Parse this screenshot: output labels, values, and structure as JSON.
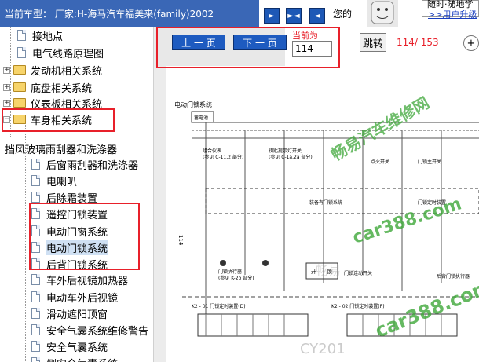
{
  "header": {
    "title": "当前车型： 厂家:H-海马汽车福美来(family)2002",
    "cut_text": "您的",
    "sign_text": "随时·随地学",
    "sign_link": ">>用户升级"
  },
  "sidebar": {
    "items": [
      {
        "label": "接地点",
        "type": "doc"
      },
      {
        "label": "电气线路原理图",
        "type": "doc"
      },
      {
        "label": "发动机相关系统",
        "type": "folder"
      },
      {
        "label": "底盘相关系统",
        "type": "folder"
      },
      {
        "label": "仪表板相关系统",
        "type": "folder"
      },
      {
        "label": "车身相关系统",
        "type": "folder-open"
      },
      {
        "label": "挡风玻璃雨刮器和洗涤器",
        "type": "doc"
      },
      {
        "label": "后窗雨刮器和洗涤器",
        "type": "doc"
      },
      {
        "label": "电喇叭",
        "type": "doc"
      },
      {
        "label": "后除霜装置",
        "type": "doc"
      },
      {
        "label": "遥控门锁装置",
        "type": "doc"
      },
      {
        "label": "电动门窗系统",
        "type": "doc"
      },
      {
        "label": "电动门锁系统",
        "type": "doc",
        "selected": true
      },
      {
        "label": "后背门锁系统",
        "type": "doc"
      },
      {
        "label": "车外后视镜加热器",
        "type": "doc"
      },
      {
        "label": "电动车外后视镜",
        "type": "doc"
      },
      {
        "label": "滑动遮阳顶窗",
        "type": "doc"
      },
      {
        "label": "安全气囊系统维修警告",
        "type": "doc"
      },
      {
        "label": "安全气囊系统",
        "type": "doc"
      },
      {
        "label": "侧安全气囊系统",
        "type": "doc"
      }
    ]
  },
  "toolbar": {
    "prev_label": "上 一 页",
    "next_label": "下 一 页",
    "current_label": "当前为",
    "current_value": "114",
    "jump_label": "跳转",
    "page_count": "114/ 153"
  },
  "diagram": {
    "title": "电动门锁系统",
    "box_label": "蓄电池",
    "page_number": "114",
    "labels": [
      "组合仪表",
      "(参见 C-11,2 部分)",
      "钥匙提示灯开关",
      "(参见 C-1a,2a 部分)",
      "装备有门锁系统",
      "门锁执行器",
      "(参见 K-2b 部分)",
      "门锁连动开关",
      "后背门锁执行器",
      "门锁定时装置",
      "K2 - 01 门锁定时装置(D)",
      "K2 - 02 门锁定时装置(P)",
      "点火开关",
      "门锁主开关",
      "开",
      "锁"
    ],
    "watermarks": [
      "car388.com",
      "car388.com",
      "畅易汽车维修网",
      "CY201",
      "畅易"
    ]
  },
  "colors": {
    "title_bar": "#3a67b6",
    "highlight": "#e8202a",
    "button_blue": "#1e5bc0",
    "watermark_green": "#3fa83a"
  }
}
